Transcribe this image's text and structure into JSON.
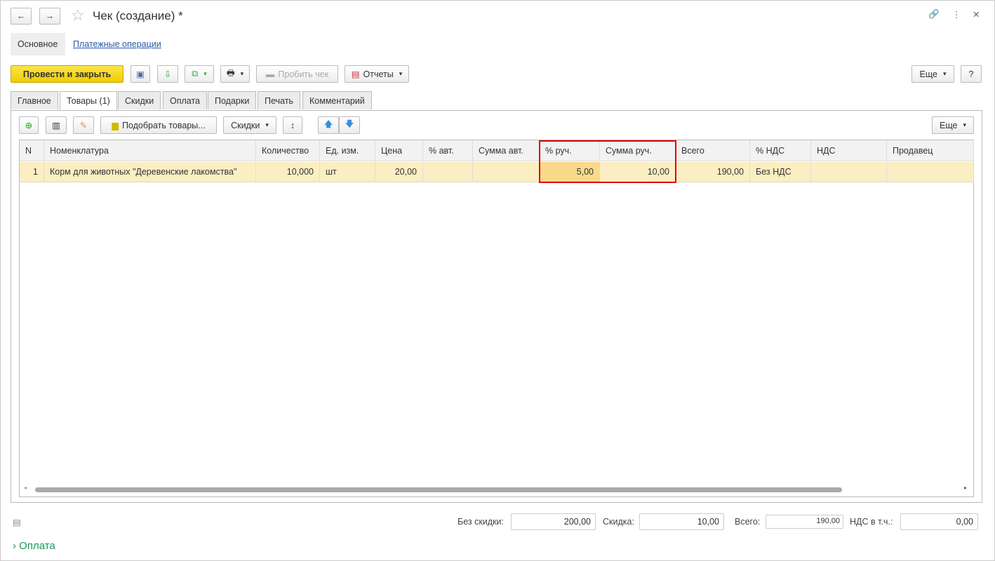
{
  "window": {
    "title": "Чек (создание) *"
  },
  "sections": [
    {
      "label": "Основное"
    },
    {
      "label": "Платежные операции"
    }
  ],
  "toolbar": {
    "post_close": "Провести и закрыть",
    "print_check": "Пробить чек",
    "reports": "Отчеты",
    "more": "Еще",
    "help": "?"
  },
  "tabs": [
    {
      "label": "Главное"
    },
    {
      "label": "Товары (1)"
    },
    {
      "label": "Скидки"
    },
    {
      "label": "Оплата"
    },
    {
      "label": "Подарки"
    },
    {
      "label": "Печать"
    },
    {
      "label": "Комментарий"
    }
  ],
  "items_toolbar": {
    "pick": "Подобрать товары...",
    "discounts": "Скидки",
    "more": "Еще"
  },
  "table": {
    "columns": [
      "N",
      "Номенклатура",
      "Количество",
      "Ед. изм.",
      "Цена",
      "% авт.",
      "Сумма авт.",
      "% руч.",
      "Сумма руч.",
      "Всего",
      "% НДС",
      "НДС",
      "Продавец"
    ],
    "rows": [
      [
        "1",
        "Корм для животных \"Деревенские лакомства\"",
        "10,000",
        "шт",
        "20,00",
        "",
        "",
        "5,00",
        "10,00",
        "190,00",
        "Без НДС",
        "",
        ""
      ]
    ]
  },
  "totals": {
    "no_discount_label": "Без скидки:",
    "no_discount": "200,00",
    "discount_label": "Скидка:",
    "discount": "10,00",
    "total_label": "Всего:",
    "total": "190,00",
    "vat_label": "НДС в т.ч.:",
    "vat": "0,00"
  },
  "payment_section": {
    "label": "Оплата"
  },
  "colors": {
    "accent": "#f5d40f",
    "highlight": "#e00000",
    "row": "#fbeec2"
  }
}
